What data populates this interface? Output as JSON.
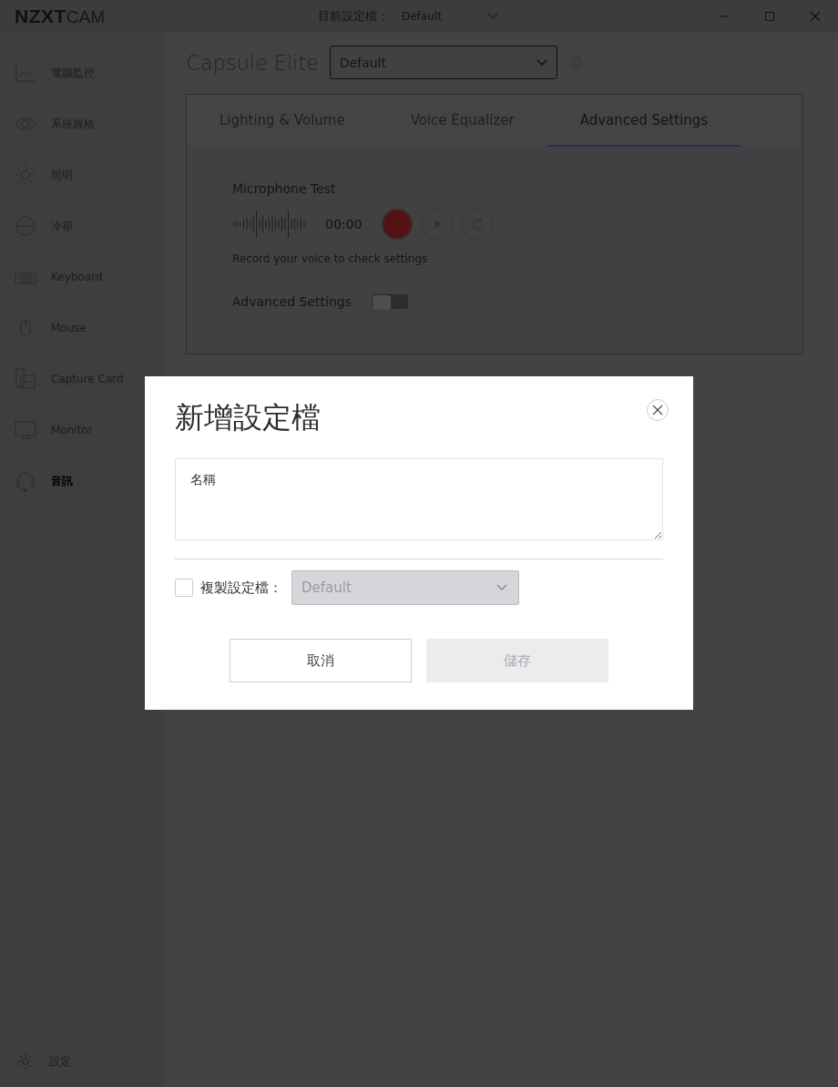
{
  "titlebar": {
    "logo_bold": "NZXT",
    "logo_light": "CAM",
    "profile_label": "目前設定檔：",
    "profile_value": "Default"
  },
  "sidebar": {
    "items": [
      {
        "label": "電腦監控",
        "selected": false
      },
      {
        "label": "系統規格",
        "selected": false
      },
      {
        "label": "照明",
        "selected": false
      },
      {
        "label": "冷卻",
        "selected": false
      },
      {
        "label": "Keyboard",
        "selected": false
      },
      {
        "label": "Mouse",
        "selected": false
      },
      {
        "label": "Capture Card",
        "selected": false
      },
      {
        "label": "Monitor",
        "selected": false
      },
      {
        "label": "音訊",
        "selected": true
      }
    ],
    "settings": "設定"
  },
  "device": {
    "name": "Capsule Elite",
    "profile": "Default"
  },
  "tabs": [
    {
      "label": "Lighting & Volume",
      "selected": false
    },
    {
      "label": "Voice Equalizer",
      "selected": false
    },
    {
      "label": "Advanced Settings",
      "selected": true
    }
  ],
  "mic_test": {
    "title": "Microphone Test",
    "time": "00:00",
    "hint": "Record your voice to check settings"
  },
  "advanced": {
    "label": "Advanced Settings",
    "on": false
  },
  "dialog": {
    "title": "新增設定檔",
    "name_field": {
      "placeholder": "名稱"
    },
    "copy": {
      "checked": false,
      "label": "複製設定檔：",
      "value": "Default",
      "disabled": true
    },
    "buttons": [
      {
        "label": "取消",
        "kind": "secondary",
        "disabled": false
      },
      {
        "label": "儲存",
        "kind": "primary",
        "disabled": true
      }
    ]
  }
}
